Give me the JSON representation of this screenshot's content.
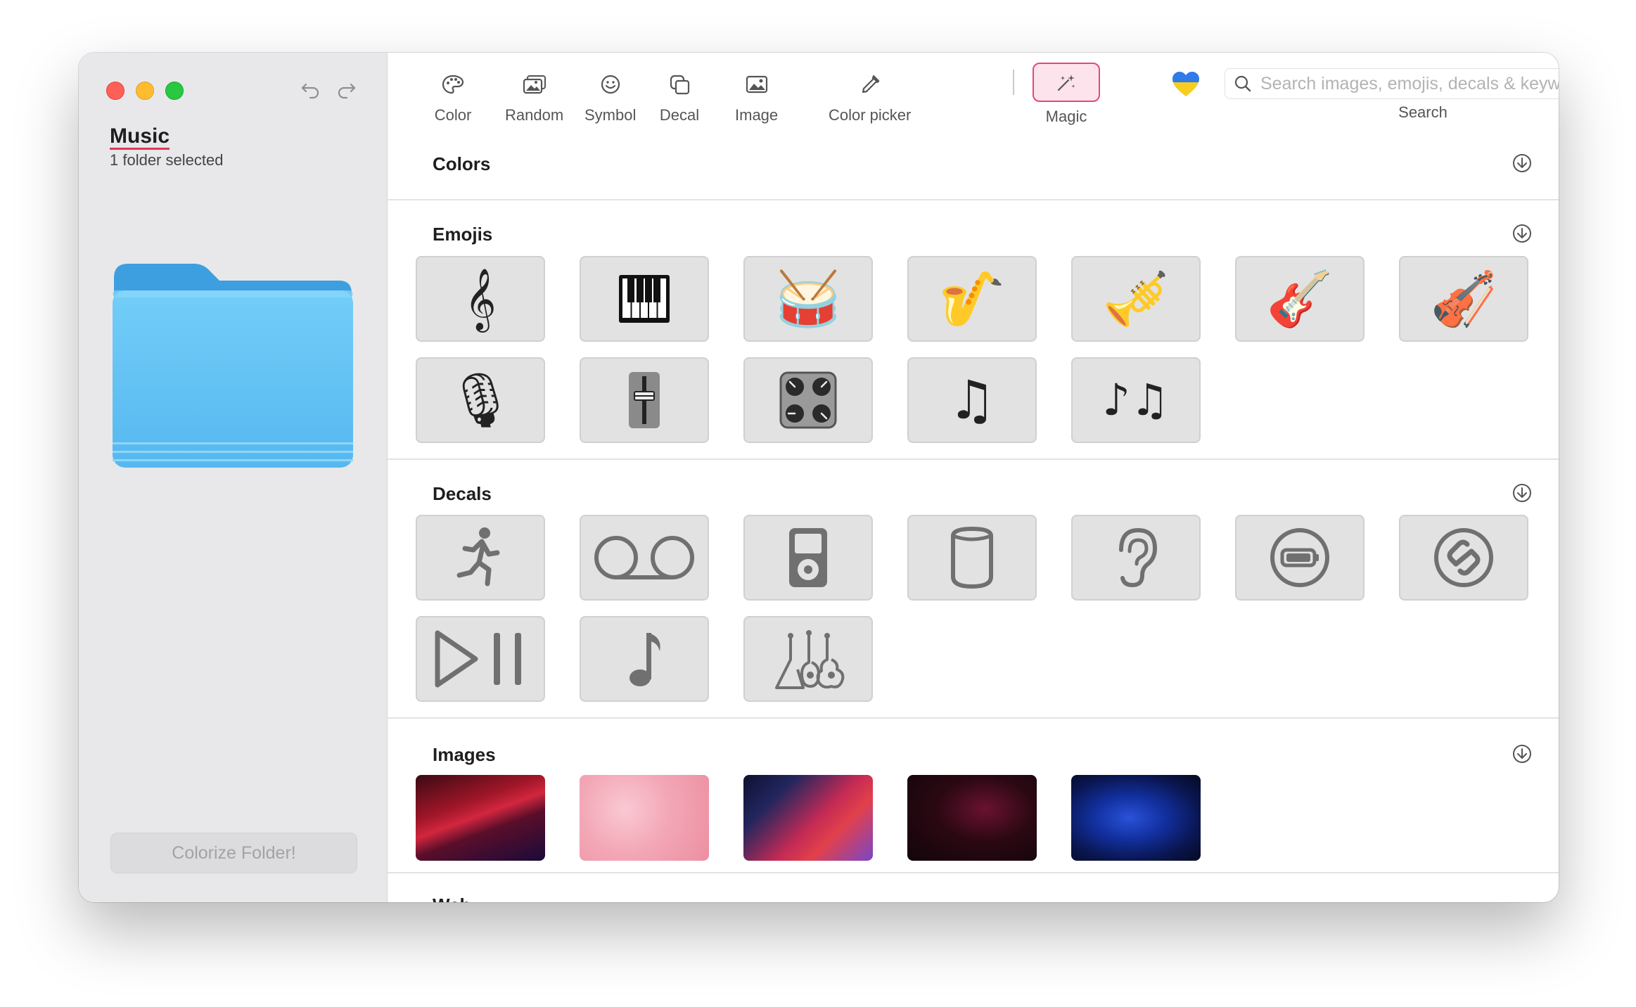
{
  "sidebar": {
    "folder_name": "Music",
    "selection_status": "1 folder selected",
    "colorize_button": "Colorize Folder!"
  },
  "toolbar": {
    "items": [
      {
        "label": "Color",
        "icon": "palette-icon"
      },
      {
        "label": "Random",
        "icon": "random-images-icon"
      },
      {
        "label": "Symbol",
        "icon": "smiley-icon"
      },
      {
        "label": "Decal",
        "icon": "decal-icon"
      },
      {
        "label": "Image",
        "icon": "photo-icon"
      },
      {
        "label": "Color picker",
        "icon": "eyedropper-icon"
      },
      {
        "label": "Magic",
        "icon": "magic-wand-icon"
      }
    ],
    "search": {
      "placeholder": "Search images, emojis, decals & keywords",
      "label": "Search"
    }
  },
  "sections": {
    "colors": {
      "title": "Colors"
    },
    "emojis": {
      "title": "Emojis",
      "items": [
        "𝄞",
        "🎹",
        "🥁",
        "🎷",
        "🎺",
        "🎸",
        "🎻",
        "🎙",
        "🎚",
        "🎛",
        "♫",
        "♪♫"
      ]
    },
    "decals": {
      "title": "Decals",
      "items": [
        "figure-run-icon",
        "voicemail-icon",
        "ipod-icon",
        "homepod-icon",
        "ear-icon",
        "battery-circle-icon",
        "shazam-icon",
        "play-pause-icon",
        "music-note-icon",
        "guitars-icon"
      ]
    },
    "images": {
      "title": "Images",
      "items": [
        "red-nebula-image",
        "pink-clouds-image",
        "gradient-image",
        "dark-marble-image",
        "blue-marble-image"
      ]
    },
    "next": {
      "title": "Web"
    }
  },
  "colors": {
    "accent": "#e0385a",
    "folder_blue": "#5bbcf3",
    "sidebar_bg": "#e8e8ea"
  }
}
